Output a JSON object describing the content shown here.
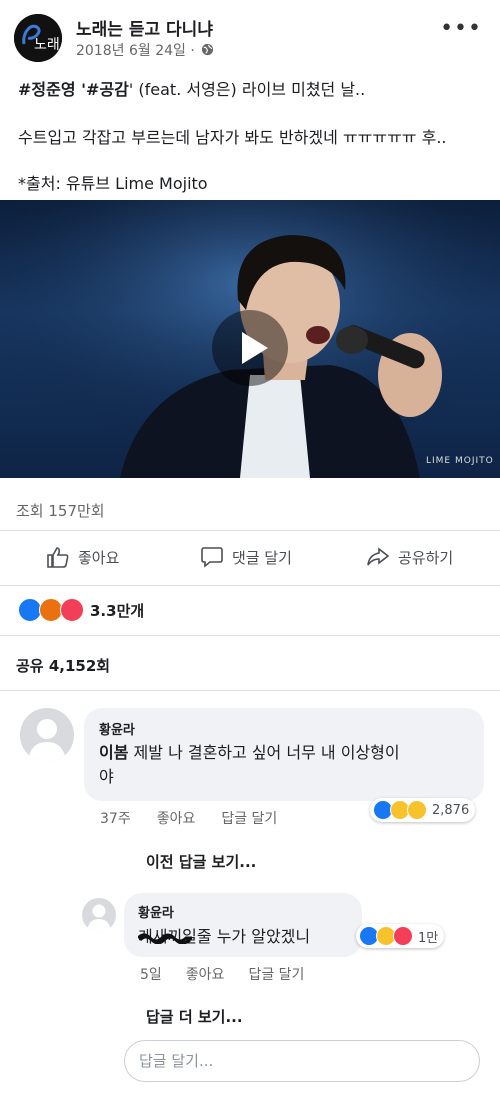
{
  "post": {
    "page_name": "노래는 듣고 다니냐",
    "logo_text": "노래",
    "date": "2018년 6월 24일 ·",
    "lines": [
      {
        "tag1": "#정준영",
        "q1": " '",
        "tag2": "#공감",
        "rest": "' (feat. 서영은) 라이브 미쳤던 날.."
      },
      "수트입고 각잡고 부르는데 남자가 봐도 반하겠네 ㅠㅠㅠㅠㅠ 후..",
      "*출처: 유튜브 Lime Mojito"
    ]
  },
  "video": {
    "watermark": "LIME MOJITO",
    "views": "조회 157만회"
  },
  "actions": {
    "like": "좋아요",
    "comment": "댓글 달기",
    "share": "공유하기"
  },
  "reactions": {
    "count": "3.3만개"
  },
  "shares": {
    "text": "공유 4,152회"
  },
  "comments": [
    {
      "author": "황윤라",
      "text_bold": "이봄",
      "text_line1": " 제발 나 결혼하고 싶어 너무 내 이상형이",
      "text_line2": "야",
      "time": "37주",
      "like": "좋아요",
      "reply": "답글 달기",
      "reaction_count": "2,876"
    }
  ],
  "view_previous_replies": "이전 답글 보기...",
  "reply": {
    "author": "황윤라",
    "redacted": "게새끼",
    "text": "일줄 누가 알았겠니",
    "time": "5일",
    "like": "좋아요",
    "reply": "답글 달기",
    "reaction_count": "1만"
  },
  "view_more_replies": "답글 더 보기...",
  "reply_input": {
    "placeholder": "답글 달기..."
  },
  "colors": {
    "like_blue": "#1877f2",
    "love_red": "#f33e58",
    "haha_yellow": "#f7c22b",
    "angry_orange": "#e9710f"
  }
}
